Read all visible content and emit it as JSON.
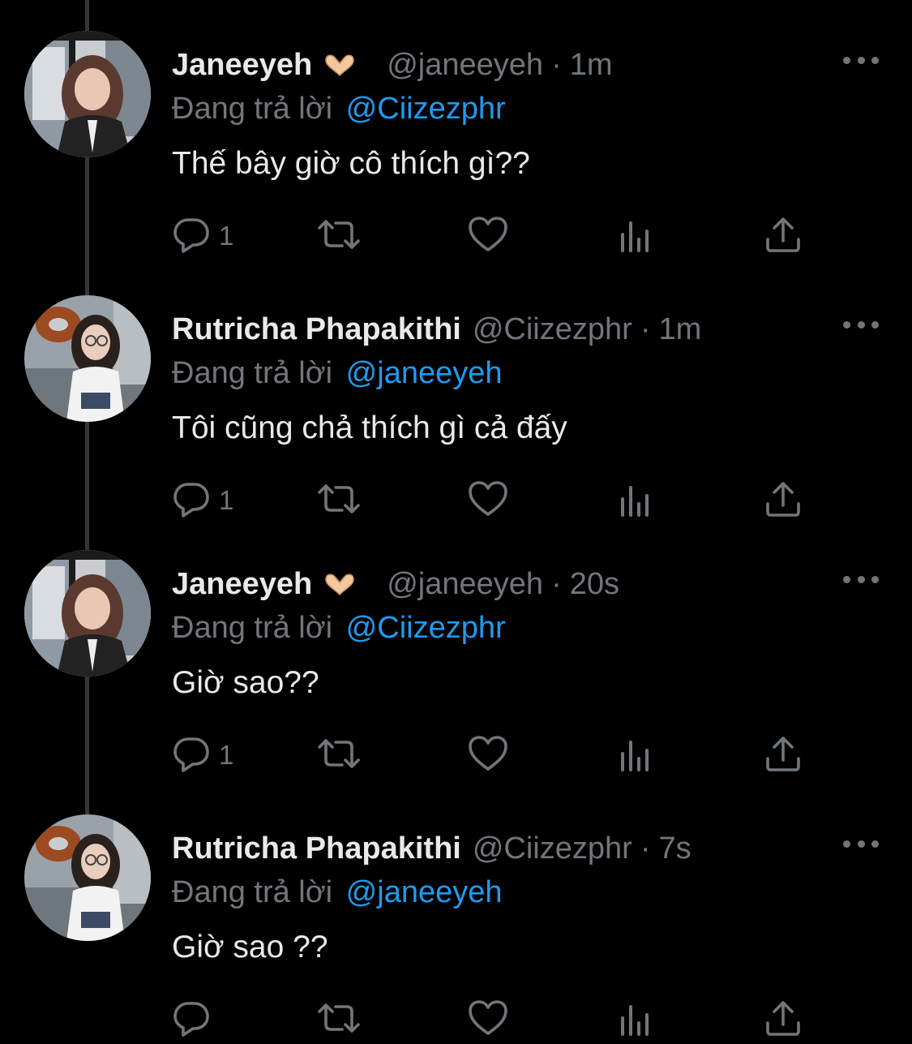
{
  "colors": {
    "background": "#000000",
    "text": "#e7e9ea",
    "secondary": "#71767b",
    "link": "#1d9bf0",
    "thread_line": "#333639"
  },
  "replying_label": "Đang trả lời",
  "tweets": [
    {
      "display_name": "Janeeyeh",
      "emoji": "heart-hands-emoji",
      "handle": "@janeeyeh",
      "separator": "·",
      "time": "1m",
      "reply_to": "@Ciizezphr",
      "text": "Thế bây giờ cô thích gì??",
      "reply_count": "1",
      "avatar": "avatar-janeeyeh"
    },
    {
      "display_name": "Rutricha Phapakithi",
      "emoji": "",
      "handle": "@Ciizezphr",
      "separator": "·",
      "time": "1m",
      "reply_to": "@janeeyeh",
      "text": "Tôi cũng chả thích gì cả đấy",
      "reply_count": "1",
      "avatar": "avatar-ciizezphr"
    },
    {
      "display_name": "Janeeyeh",
      "emoji": "heart-hands-emoji",
      "handle": "@janeeyeh",
      "separator": "·",
      "time": "20s",
      "reply_to": "@Ciizezphr",
      "text": "Giờ sao??",
      "reply_count": "1",
      "avatar": "avatar-janeeyeh"
    },
    {
      "display_name": "Rutricha Phapakithi",
      "emoji": "",
      "handle": "@Ciizezphr",
      "separator": "·",
      "time": "7s",
      "reply_to": "@janeeyeh",
      "text": "Giờ sao ??",
      "reply_count": "",
      "avatar": "avatar-ciizezphr"
    }
  ],
  "icons": {
    "reply": "reply-icon",
    "retweet": "retweet-icon",
    "like": "heart-icon",
    "views": "views-chart-icon",
    "share": "share-icon",
    "more": "more-dots-icon"
  }
}
